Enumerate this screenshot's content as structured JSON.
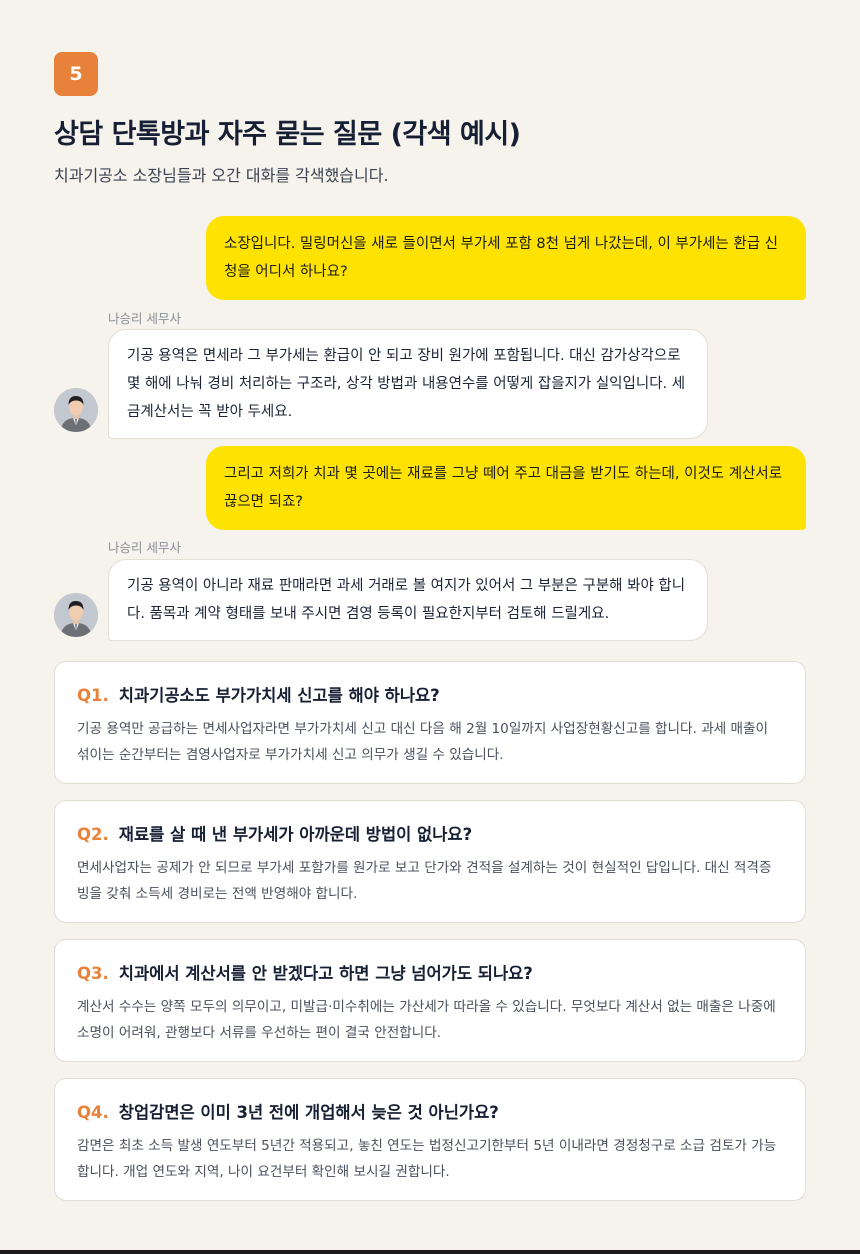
{
  "badge": "5",
  "title": "상담 단톡방과 자주 묻는 질문 (각색 예시)",
  "subtitle": "치과기공소 소장님들과 오간 대화를 각색했습니다.",
  "chat": [
    {
      "role": "user",
      "text": "소장입니다. 밀링머신을 새로 들이면서 부가세 포함 8천 넘게 나갔는데, 이 부가세는 환급 신청을 어디서 하나요?"
    },
    {
      "role": "advisor",
      "sender": "나승리 세무사",
      "text": "기공 용역은 면세라 그 부가세는 환급이 안 되고 장비 원가에 포함됩니다. 대신 감가상각으로 몇 해에 나눠 경비 처리하는 구조라, 상각 방법과 내용연수를 어떻게 잡을지가 실익입니다. 세금계산서는 꼭 받아 두세요."
    },
    {
      "role": "user",
      "text": "그리고 저희가 치과 몇 곳에는 재료를 그냥 떼어 주고 대금을 받기도 하는데, 이것도 계산서로 끊으면 되죠?"
    },
    {
      "role": "advisor",
      "sender": "나승리 세무사",
      "text": "기공 용역이 아니라 재료 판매라면 과세 거래로 볼 여지가 있어서 그 부분은 구분해 봐야 합니다. 품목과 계약 형태를 보내 주시면 겸영 등록이 필요한지부터 검토해 드릴게요."
    }
  ],
  "faq": [
    {
      "num": "Q1.",
      "q": "치과기공소도 부가가치세 신고를 해야 하나요?",
      "a": "기공 용역만 공급하는 면세사업자라면 부가가치세 신고 대신 다음 해 2월 10일까지 사업장현황신고를 합니다. 과세 매출이 섞이는 순간부터는 겸영사업자로 부가가치세 신고 의무가 생길 수 있습니다."
    },
    {
      "num": "Q2.",
      "q": "재료를 살 때 낸 부가세가 아까운데 방법이 없나요?",
      "a": "면세사업자는 공제가 안 되므로 부가세 포함가를 원가로 보고 단가와 견적을 설계하는 것이 현실적인 답입니다. 대신 적격증빙을 갖춰 소득세 경비로는 전액 반영해야 합니다."
    },
    {
      "num": "Q3.",
      "q": "치과에서 계산서를 안 받겠다고 하면 그냥 넘어가도 되나요?",
      "a": "계산서 수수는 양쪽 모두의 의무이고, 미발급·미수취에는 가산세가 따라올 수 있습니다. 무엇보다 계산서 없는 매출은 나중에 소명이 어려워, 관행보다 서류를 우선하는 편이 결국 안전합니다."
    },
    {
      "num": "Q4.",
      "q": "창업감면은 이미 3년 전에 개업해서 늦은 것 아닌가요?",
      "a": "감면은 최초 소득 발생 연도부터 5년간 적용되고, 놓친 연도는 법정신고기한부터 5년 이내라면 경정청구로 소급 검토가 가능합니다. 개업 연도와 지역, 나이 요건부터 확인해 보시길 권합니다."
    }
  ]
}
